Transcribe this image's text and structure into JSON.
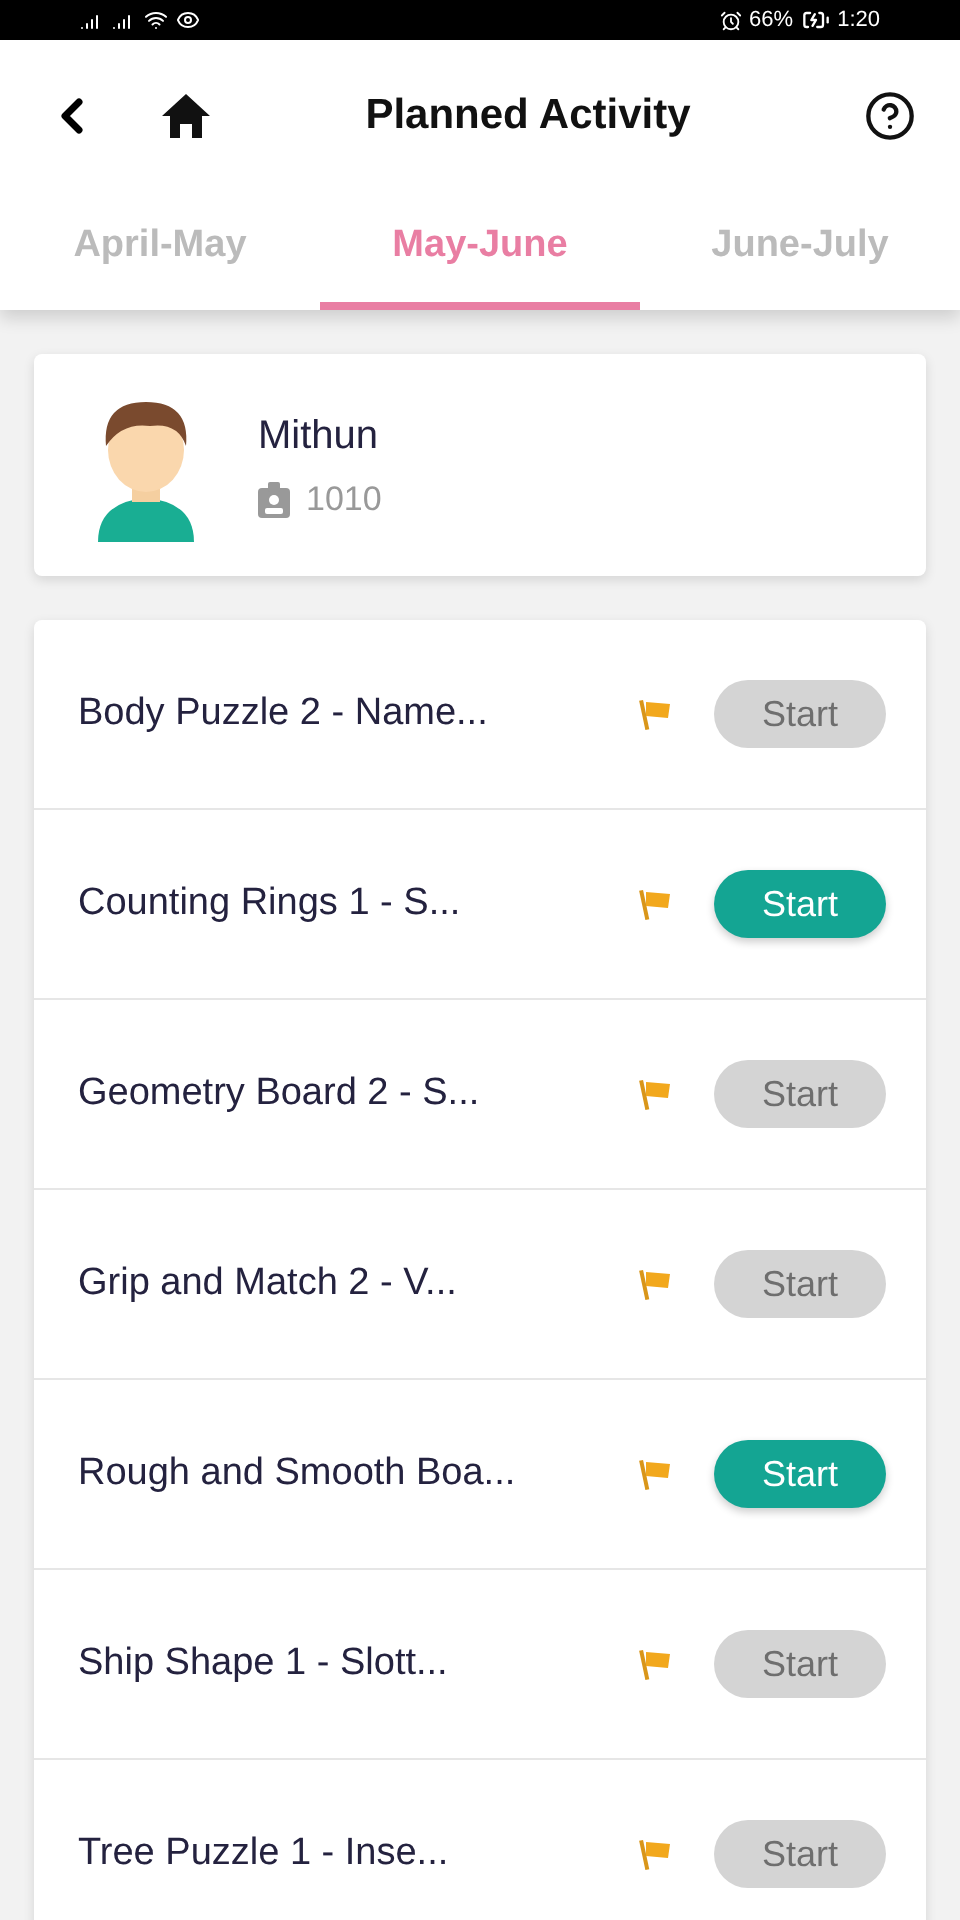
{
  "status_bar": {
    "battery": "66%",
    "time": "1:20"
  },
  "header": {
    "title": "Planned Activity"
  },
  "tabs": [
    {
      "label": "April-May",
      "selected": false
    },
    {
      "label": "May-June",
      "selected": true
    },
    {
      "label": "June-July",
      "selected": false
    }
  ],
  "profile": {
    "name": "Mithun",
    "id": "1010"
  },
  "activities": [
    {
      "name": "Body Puzzle 2 - Name...",
      "button": "Start",
      "disabled": true
    },
    {
      "name": "Counting Rings 1 - S...",
      "button": "Start",
      "disabled": false
    },
    {
      "name": "Geometry Board 2 - S...",
      "button": "Start",
      "disabled": true
    },
    {
      "name": "Grip and Match 2 - V...",
      "button": "Start",
      "disabled": true
    },
    {
      "name": "Rough and Smooth Boa...",
      "button": "Start",
      "disabled": false
    },
    {
      "name": "Ship Shape 1 - Slott...",
      "button": "Start",
      "disabled": true
    },
    {
      "name": "Tree Puzzle 1 - Inse...",
      "button": "Start",
      "disabled": true
    }
  ]
}
